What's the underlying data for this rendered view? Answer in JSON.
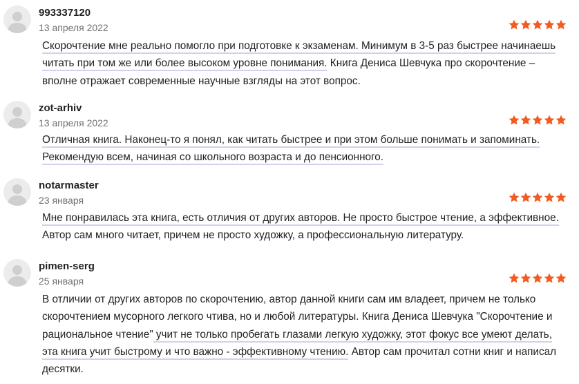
{
  "colors": {
    "star": "#f25c21",
    "highlight_underline": "#d9cdee",
    "avatar_bg": "#ececec",
    "avatar_figure": "#cfcfcf"
  },
  "rating_icon": "star-icon",
  "avatar_icon": "user-silhouette-icon",
  "reviews": [
    {
      "author": "993337120",
      "date": "13 апреля 2022",
      "rating": 5,
      "segments": [
        {
          "text": "Скорочтение мне реально помогло при подготовке к экзаменам. Минимум в 3-5 раз быстрее начинаешь читать при том же или более высоком уровне понимания.",
          "highlight": true
        },
        {
          "text": " Книга Дениса Шевчука про скорочтение – вполне отражает современные научные взгляды на этот вопрос.",
          "highlight": false
        }
      ]
    },
    {
      "author": "zot-arhiv",
      "date": "13 апреля 2022",
      "rating": 5,
      "segments": [
        {
          "text": "Отличная книга. Наконец-то я понял, как читать быстрее и при этом больше понимать и запоминать. Рекомендую всем, начиная со школьного возраста и до пенсионного.",
          "highlight": true
        }
      ]
    },
    {
      "author": "notarmaster",
      "date": "23 января",
      "rating": 5,
      "segments": [
        {
          "text": "Мне понравилась эта книга, есть отличия от других авторов. Не просто быстрое чтение, а эффективное.",
          "highlight": true
        },
        {
          "text": " Автор сам много читает, причем не просто художку, а профессиональную литературу.",
          "highlight": false
        }
      ]
    },
    {
      "author": "pimen-serg",
      "date": "25 января",
      "rating": 5,
      "segments": [
        {
          "text": "В отличии от других авторов по скорочтению, автор данной книги сам им владеет, причем не только скорочтением мусорного легкого чтива, но и любой литературы. Книга Дениса Шевчука \"Скорочтение и рациональное чтение\"",
          "highlight": false
        },
        {
          "text": " учит не только пробегать глазами легкую художку, этот фокус все умеют делать, эта книга учит быстрому и что важно - эффективному чтению.",
          "highlight": true
        },
        {
          "text": " Автор сам прочитал сотни книг и написал десятки.",
          "highlight": false
        }
      ]
    }
  ]
}
